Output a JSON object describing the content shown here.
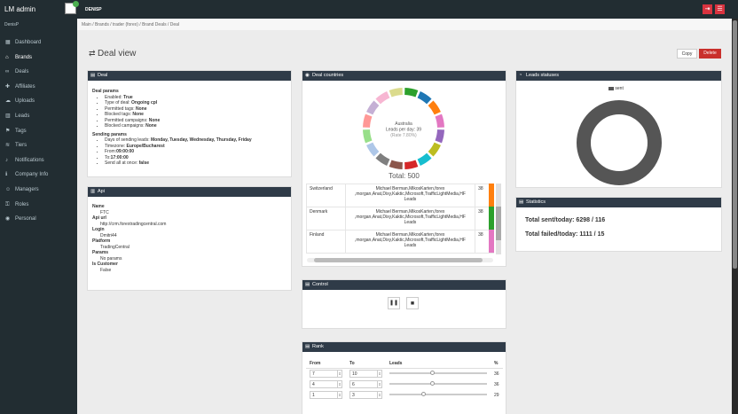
{
  "app": {
    "title": "LM admin",
    "username": "DENISP",
    "badge": ""
  },
  "sidebar": {
    "header": "DenisP",
    "items": [
      {
        "label": "Dashboard",
        "icon": "dashboard-icon"
      },
      {
        "label": "Brands",
        "icon": "bank-icon"
      },
      {
        "label": "Deals",
        "icon": "handshake-icon"
      },
      {
        "label": "Affiliates",
        "icon": "puzzle-icon"
      },
      {
        "label": "Uploads",
        "icon": "cloud-upload-icon"
      },
      {
        "label": "Leads",
        "icon": "bar-chart-icon"
      },
      {
        "label": "Tags",
        "icon": "tags-icon"
      },
      {
        "label": "Tiers",
        "icon": "layers-icon"
      },
      {
        "label": "Notifications",
        "icon": "bell-icon"
      },
      {
        "label": "Company Info",
        "icon": "info-icon"
      },
      {
        "label": "Managers",
        "icon": "users-icon"
      },
      {
        "label": "Roles",
        "icon": "key-icon"
      },
      {
        "label": "Personal",
        "icon": "globe-icon"
      }
    ]
  },
  "breadcrumb": "Main / Brands / trader (forex) / Brand Deals / Deal",
  "page": {
    "title": "Deal view",
    "copy": "Copy",
    "delete": "Delete"
  },
  "deal": {
    "title": "Deal",
    "params_h": "Deal params",
    "params": [
      [
        "Enabled: ",
        "True"
      ],
      [
        "Type of deal: ",
        "Ongoing cpl"
      ],
      [
        "Permitted tags: ",
        "None"
      ],
      [
        "Blocked tags: ",
        "None"
      ],
      [
        "Permitted campaigns: ",
        "None"
      ],
      [
        "Blocked campaigns: ",
        "None"
      ]
    ],
    "sending_h": "Sending params",
    "sending": [
      [
        "Days of sending leads: ",
        "Monday, Tuesday, Wednesday, Thursday, Friday"
      ],
      [
        "Timezone: ",
        "Europe/Bucharest"
      ],
      [
        "From:",
        "09:00:00"
      ],
      [
        "To:",
        "17:00:00"
      ],
      [
        "Send all at once: ",
        "false"
      ]
    ]
  },
  "api": {
    "title": "Api",
    "fields": [
      [
        "Name",
        "FTC"
      ],
      [
        "Api url",
        "http://crm.forextradingcentral.com"
      ],
      [
        "Login",
        "Dmitri44"
      ],
      [
        "Platform",
        "TradingCentral"
      ],
      [
        "Params",
        "No params"
      ],
      [
        "Is Customer",
        "False"
      ]
    ]
  },
  "countries": {
    "title": "Deal countries",
    "center": [
      "Australia",
      "Leads per day: 39",
      "(Rate 7.80%)"
    ],
    "total": "Total: 500",
    "rows": [
      [
        "Switzerland",
        "Michael Berman,MikosKarten,forex ,morgan,Anat,Dixy,Kaktic,Microsoft,TrafficLightMedia,HF Leads",
        "38"
      ],
      [
        "Denmark",
        "Michael Berman,MikosKarten,forex ,morgan,Anat,Dixy,Kaktic,Microsoft,TrafficLightMedia,HF Leads",
        "38"
      ],
      [
        "Finland",
        "Michael Berman,MikosKarten,forex ,morgan,Anat,Dixy,Kaktic,Microsoft,TrafficLightMedia,HF Leads",
        "38"
      ]
    ],
    "colors": [
      "#2ca02c",
      "#1f77b4",
      "#ff7f0e",
      "#e377c2",
      "#9467bd",
      "#bcbd22",
      "#17becf",
      "#d62728",
      "#8c564b",
      "#7f7f7f",
      "#aec7e8",
      "#98df8a",
      "#ff9896",
      "#c5b0d5",
      "#f7b6d2",
      "#dbdb8d"
    ]
  },
  "leads": {
    "title": "Leads statuses",
    "legend": "sent",
    "color": "#555555"
  },
  "stats": {
    "title": "Statistics",
    "sent": "Total sent/today: 6298 / 116",
    "failed": "Total failed/today: 1111 / 15"
  },
  "control": {
    "title": "Control"
  },
  "rank": {
    "title": "Rank",
    "headers": [
      "From",
      "To",
      "Leads",
      "%"
    ],
    "rows": [
      [
        "7",
        "10",
        0.42,
        "36"
      ],
      [
        "4",
        "6",
        0.42,
        "36"
      ],
      [
        "1",
        "3",
        0.33,
        "29"
      ]
    ]
  }
}
